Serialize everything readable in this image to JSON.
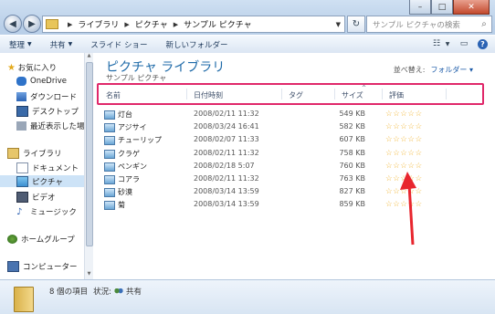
{
  "address": {
    "crumbs": [
      "ライブラリ",
      "ピクチャ",
      "サンプル ピクチャ"
    ],
    "search_placeholder": "サンプル ピクチャの検索"
  },
  "toolbar": {
    "organize": "整理",
    "share": "共有",
    "slideshow": "スライド ショー",
    "new_folder": "新しいフォルダー"
  },
  "nav": {
    "favorites": "お気に入り",
    "onedrive": "OneDrive",
    "downloads": "ダウンロード",
    "desktop": "デスクトップ",
    "recent": "最近表示した場所",
    "libraries": "ライブラリ",
    "documents": "ドキュメント",
    "pictures": "ピクチャ",
    "videos": "ビデオ",
    "music": "ミュージック",
    "homegroup": "ホームグループ",
    "computer": "コンピューター"
  },
  "main": {
    "title": "ピクチャ ライブラリ",
    "subtitle": "サンプル ピクチャ",
    "arrange_label": "並べ替え:",
    "arrange_value": "フォルダー ▾",
    "columns": {
      "name": "名前",
      "date": "日付時刻",
      "tags": "タグ",
      "size": "サイズ",
      "rating": "評価"
    },
    "files": [
      {
        "name": "灯台",
        "date": "2008/02/11 11:32",
        "size": "549 KB",
        "rating": "☆☆☆☆☆"
      },
      {
        "name": "アジサイ",
        "date": "2008/03/24 16:41",
        "size": "582 KB",
        "rating": "☆☆☆☆☆"
      },
      {
        "name": "チューリップ",
        "date": "2008/02/07 11:33",
        "size": "607 KB",
        "rating": "☆☆☆☆☆"
      },
      {
        "name": "クラゲ",
        "date": "2008/02/11 11:32",
        "size": "758 KB",
        "rating": "☆☆☆☆☆"
      },
      {
        "name": "ペンギン",
        "date": "2008/02/18 5:07",
        "size": "760 KB",
        "rating": "☆☆☆☆☆"
      },
      {
        "name": "コアラ",
        "date": "2008/02/11 11:32",
        "size": "763 KB",
        "rating": "☆☆☆☆☆"
      },
      {
        "name": "砂漠",
        "date": "2008/03/14 13:59",
        "size": "827 KB",
        "rating": "☆☆☆☆☆"
      },
      {
        "name": "菊",
        "date": "2008/03/14 13:59",
        "size": "859 KB",
        "rating": "☆☆☆☆☆"
      }
    ]
  },
  "details": {
    "count": "8 個の項目",
    "state_label": "状況:",
    "state_value": "共有"
  },
  "colors": {
    "highlight_border": "#e0286a",
    "arrow": "#e8262e",
    "library_title": "#1e6aa8"
  }
}
